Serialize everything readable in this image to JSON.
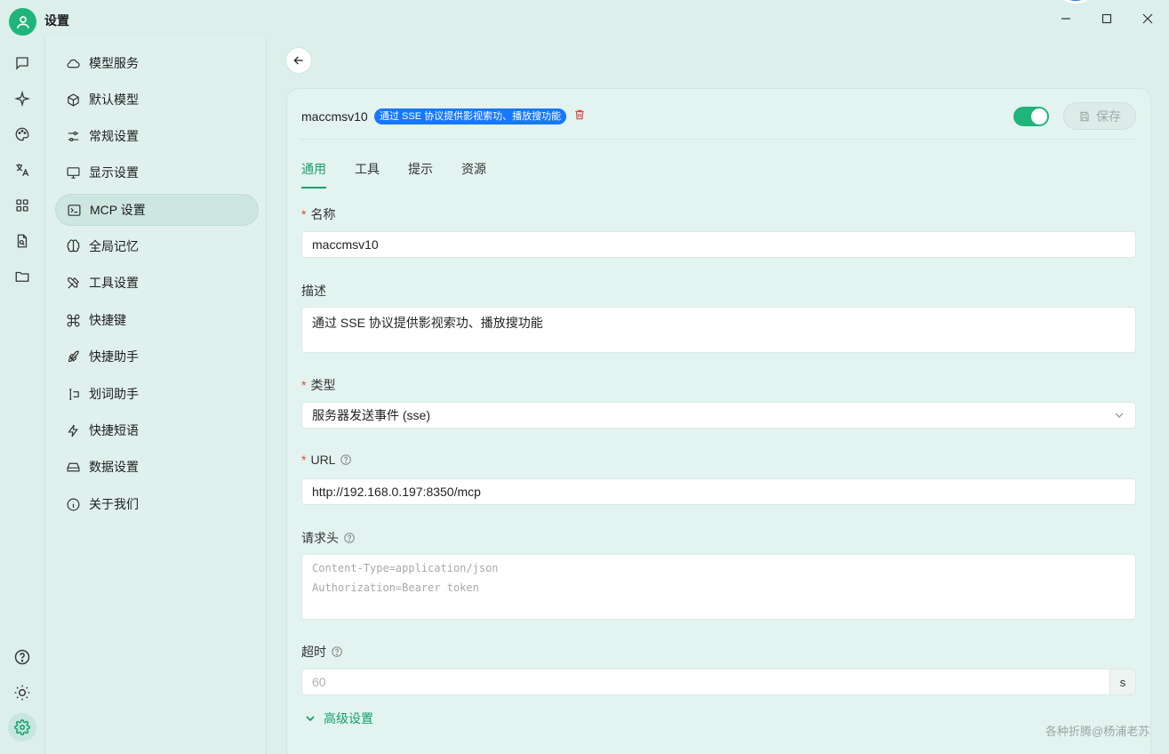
{
  "window": {
    "title": "设置"
  },
  "sidebar": {
    "items": [
      {
        "label": "模型服务",
        "icon": "cloud-icon"
      },
      {
        "label": "默认模型",
        "icon": "cube-icon"
      },
      {
        "label": "常规设置",
        "icon": "sliders-icon"
      },
      {
        "label": "显示设置",
        "icon": "monitor-icon"
      },
      {
        "label": "MCP 设置",
        "icon": "terminal-icon"
      },
      {
        "label": "全局记忆",
        "icon": "brain-icon"
      },
      {
        "label": "工具设置",
        "icon": "tools-icon"
      },
      {
        "label": "快捷键",
        "icon": "command-icon"
      },
      {
        "label": "快捷助手",
        "icon": "rocket-icon"
      },
      {
        "label": "划词助手",
        "icon": "text-cursor-icon"
      },
      {
        "label": "快捷短语",
        "icon": "zap-icon"
      },
      {
        "label": "数据设置",
        "icon": "drive-icon"
      },
      {
        "label": "关于我们",
        "icon": "info-icon"
      }
    ],
    "active_index": 4
  },
  "server": {
    "name": "maccmsv10",
    "tag": "通过 SSE 协议提供影视索功、播放搜功能",
    "enabled": true,
    "save_label": "保存"
  },
  "tabs": [
    "通用",
    "工具",
    "提示",
    "资源"
  ],
  "form": {
    "name": {
      "label": "名称",
      "value": "maccmsv10"
    },
    "description": {
      "label": "描述",
      "value": "通过 SSE 协议提供影视索功、播放搜功能"
    },
    "type": {
      "label": "类型",
      "value": "服务器发送事件 (sse)"
    },
    "url": {
      "label": "URL",
      "value": "http://192.168.0.197:8350/mcp"
    },
    "headers": {
      "label": "请求头",
      "placeholder_line1": "Content-Type=application/json",
      "placeholder_line2": "Authorization=Bearer token"
    },
    "timeout": {
      "label": "超时",
      "placeholder": "60",
      "suffix": "s"
    },
    "advanced_label": "高级设置"
  },
  "watermark": "各种折腾@杨浦老苏",
  "colors": {
    "accent": "#12a06b",
    "tag": "#1677ff",
    "danger": "#e0453a"
  }
}
